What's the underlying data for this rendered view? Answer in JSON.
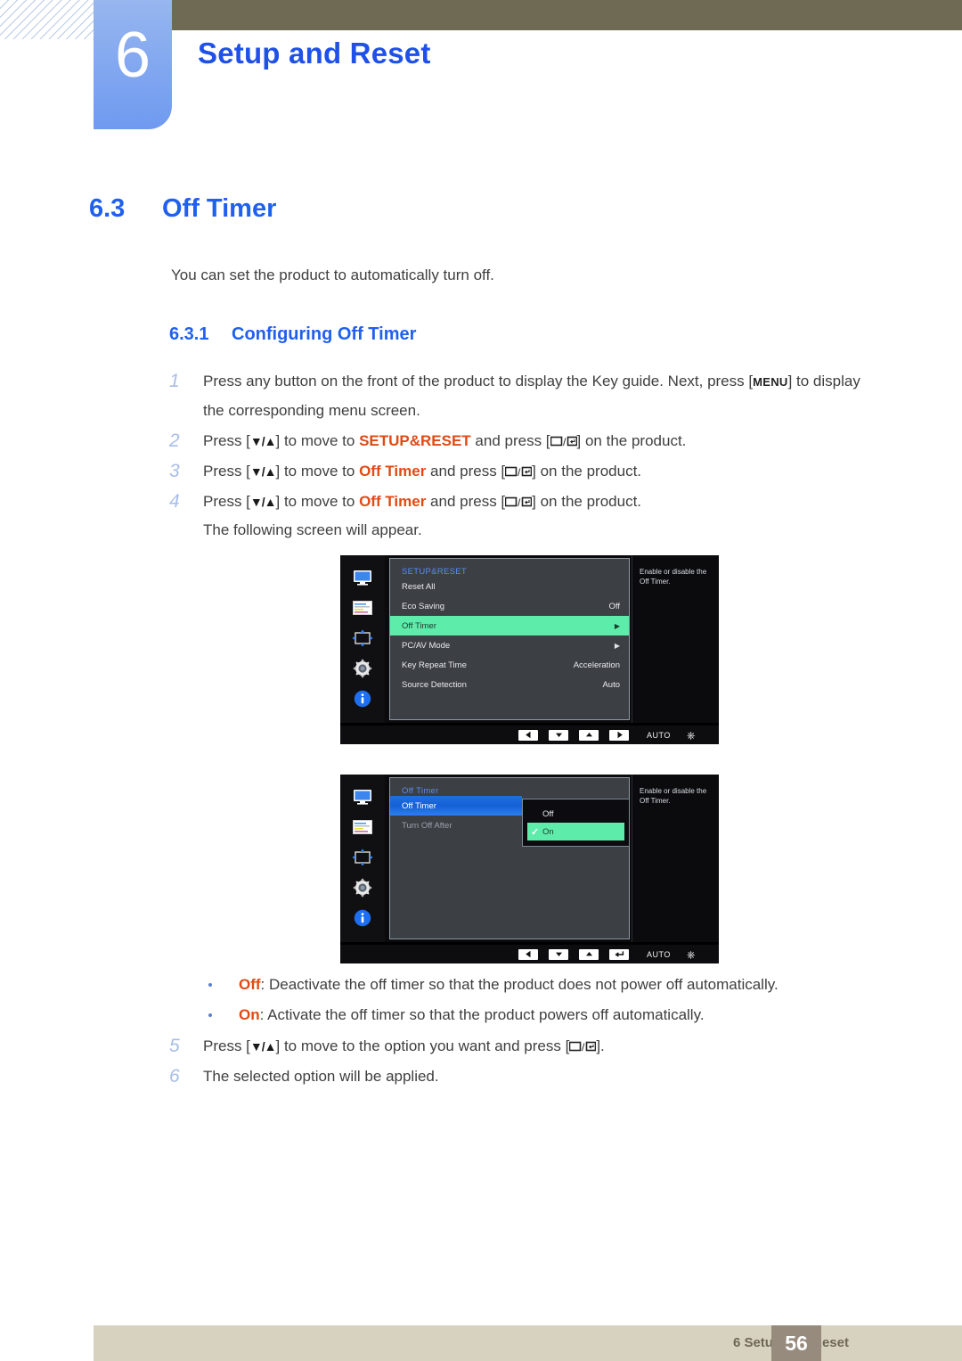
{
  "header": {
    "chapter_number": "6",
    "chapter_title": "Setup and Reset"
  },
  "section": {
    "number": "6.3",
    "title": "Off Timer",
    "intro": "You can set the product to automatically turn off.",
    "subsection_number": "6.3.1",
    "subsection_title": "Configuring Off Timer"
  },
  "steps": [
    {
      "index": "1",
      "part_a": "Press any button on the front of the product to display the Key guide. Next, press [",
      "key": "MENU",
      "part_b": "] to display",
      "line2": "the corresponding menu screen."
    },
    {
      "index": "2",
      "pre": "Press [",
      "arrows": "▼/▲",
      "mid": "] to move to ",
      "target": "SETUP&RESET",
      "post": " and press [",
      "tail": "] on the product."
    },
    {
      "index": "3",
      "pre": "Press [",
      "arrows": "▼/▲",
      "mid": "] to move to ",
      "target": "Off Timer",
      "post": " and press [",
      "tail": "] on the product."
    },
    {
      "index": "4",
      "pre": "Press [",
      "arrows": "▼/▲",
      "mid": "] to move to ",
      "target": "Off Timer",
      "post": " and press [",
      "tail": "] on the product.",
      "line2": "The following screen will appear."
    }
  ],
  "osd_1": {
    "menu_title": "SETUP&RESET",
    "rows": [
      {
        "label": "Reset All",
        "value": ""
      },
      {
        "label": "Eco Saving",
        "value": "Off"
      },
      {
        "label": "Off Timer",
        "value": "▶",
        "state": "selected-green"
      },
      {
        "label": "PC/AV Mode",
        "value": "▶"
      },
      {
        "label": "Key Repeat Time",
        "value": "Acceleration"
      },
      {
        "label": "Source Detection",
        "value": "Auto"
      }
    ],
    "help_text": "Enable or disable the Off Timer.",
    "bottom_bar": {
      "auto_label": "AUTO"
    },
    "sidebar_icons": [
      "monitor-icon",
      "color-bars-icon",
      "position-arrows-icon",
      "gear-icon",
      "info-icon"
    ]
  },
  "osd_2": {
    "menu_title": "Off Timer",
    "rows": [
      {
        "label": "Off Timer",
        "state": "selected-blue"
      },
      {
        "label": "Turn Off After",
        "state": "dim"
      }
    ],
    "dropdown": [
      {
        "label": "Off",
        "checked": false
      },
      {
        "label": "On",
        "checked": true
      }
    ],
    "help_text": "Enable or disable the Off Timer.",
    "bottom_bar": {
      "auto_label": "AUTO"
    },
    "sidebar_icons": [
      "monitor-icon",
      "color-bars-icon",
      "position-arrows-icon",
      "gear-icon",
      "info-icon"
    ]
  },
  "bullets": [
    {
      "term": "Off",
      "text": ": Deactivate the off timer so that the product does not power off automatically."
    },
    {
      "term": "On",
      "text": ": Activate the off timer so that the product powers off automatically."
    }
  ],
  "steps_after": [
    {
      "index": "5",
      "pre": "Press [",
      "arrows": "▼/▲",
      "mid": "] to move to the option you want and press [",
      "tail": "]."
    },
    {
      "index": "6",
      "plain": "The selected option will be applied."
    }
  ],
  "footer": {
    "text": "6 Setup and Reset",
    "page": "56"
  },
  "colors": {
    "accent_blue": "#2060ef",
    "highlight_orange": "#e04a14",
    "header_bar": "#6e6a53",
    "chapter_tab": "#6f9af0",
    "osd_green": "#5eecaa",
    "osd_blue": "#1f6fe0",
    "footer_bar": "#d7d2c0",
    "page_badge": "#978b7d"
  }
}
